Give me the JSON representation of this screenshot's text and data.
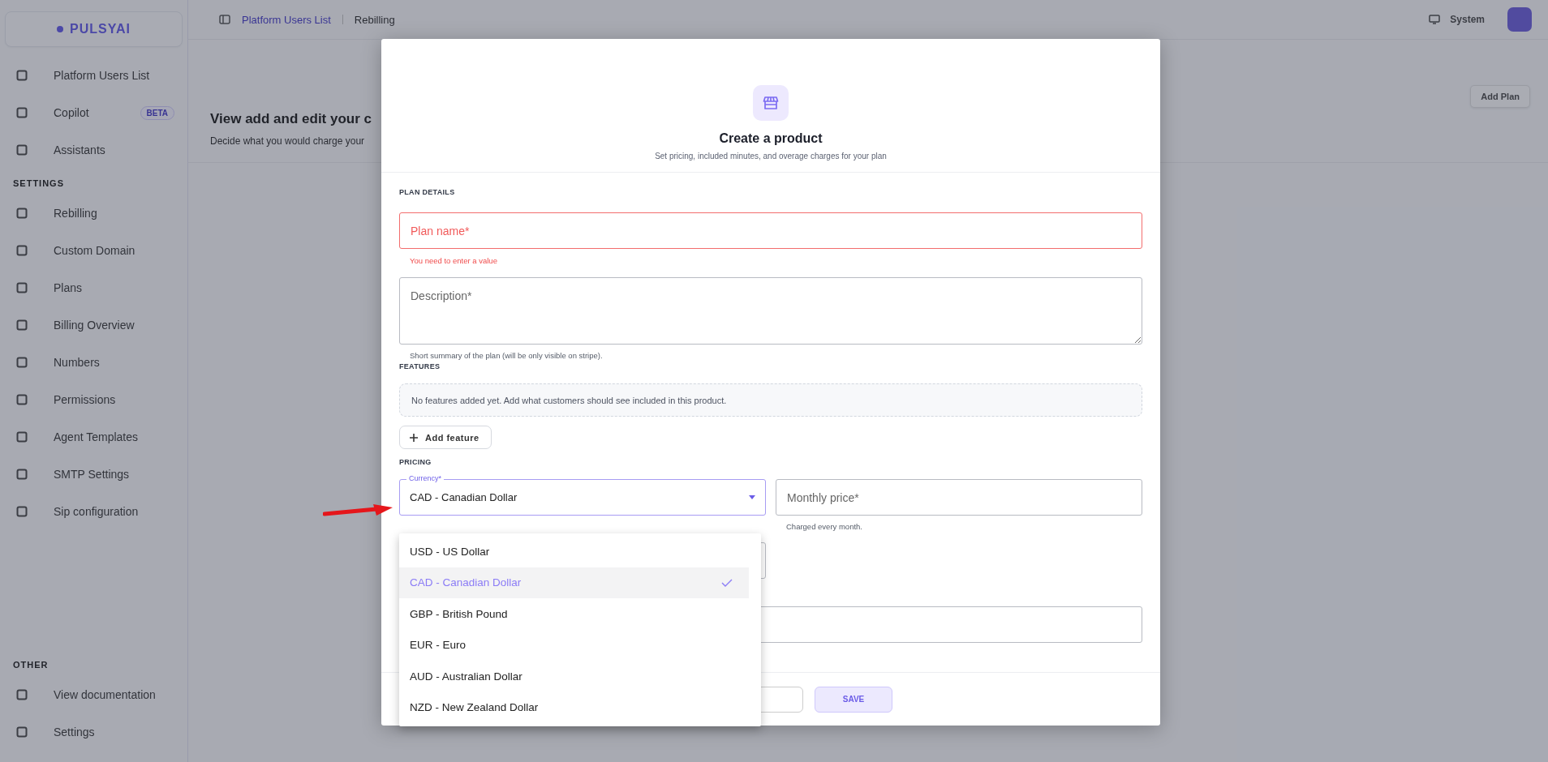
{
  "sidebar": {
    "logo": "PULSYAI",
    "groups": [
      {
        "items": [
          {
            "label": "Platform Users List"
          },
          {
            "label": "Copilot",
            "badge": "BETA"
          },
          {
            "label": "Assistants"
          }
        ]
      },
      {
        "heading": "SETTINGS",
        "items": [
          {
            "label": "Rebilling"
          },
          {
            "label": "Custom Domain"
          },
          {
            "label": "Plans"
          },
          {
            "label": "Billing Overview"
          },
          {
            "label": "Numbers"
          },
          {
            "label": "Permissions"
          },
          {
            "label": "Agent Templates"
          },
          {
            "label": "SMTP Settings"
          },
          {
            "label": "Sip configuration"
          }
        ]
      },
      {
        "heading": "OTHER",
        "items": [
          {
            "label": "View documentation"
          },
          {
            "label": "Settings"
          }
        ]
      }
    ]
  },
  "topbar": {
    "breadcrumbs": [
      "Platform Users List",
      "Rebilling"
    ],
    "theme_button": "System"
  },
  "page": {
    "title": "View add and edit your c",
    "subtitle": "Decide what you would charge your",
    "add_button": "Add Plan"
  },
  "modal": {
    "title": "Create a product",
    "subtitle": "Set pricing, included minutes, and overage charges for your plan",
    "plan_details": {
      "heading": "PLAN DETAILS",
      "name_field": {
        "placeholder": "Plan name*",
        "invalid": true,
        "error": "You need to enter a value"
      },
      "description_field": {
        "placeholder": "Description*",
        "hint": "Short summary of the plan (will be only visible on stripe)."
      }
    },
    "features": {
      "heading": "FEATURES",
      "empty_text": "No features added yet. Add what customers should see included in this product.",
      "add_button": "Add feature"
    },
    "pricing": {
      "heading": "PRICING",
      "currency": {
        "label": "Currency*",
        "value": "CAD - Canadian Dollar",
        "open": true,
        "options": [
          {
            "label": "USD - US Dollar",
            "selected": false
          },
          {
            "label": "CAD - Canadian Dollar",
            "selected": true
          },
          {
            "label": "GBP - British Pound",
            "selected": false
          },
          {
            "label": "EUR - Euro",
            "selected": false
          },
          {
            "label": "AUD - Australian Dollar",
            "selected": false
          },
          {
            "label": "NZD - New Zealand Dollar",
            "selected": false
          }
        ]
      },
      "monthly_price": {
        "placeholder": "Monthly price*",
        "hint": "Charged every month."
      }
    },
    "footer": {
      "save_button": "SAVE"
    }
  }
}
